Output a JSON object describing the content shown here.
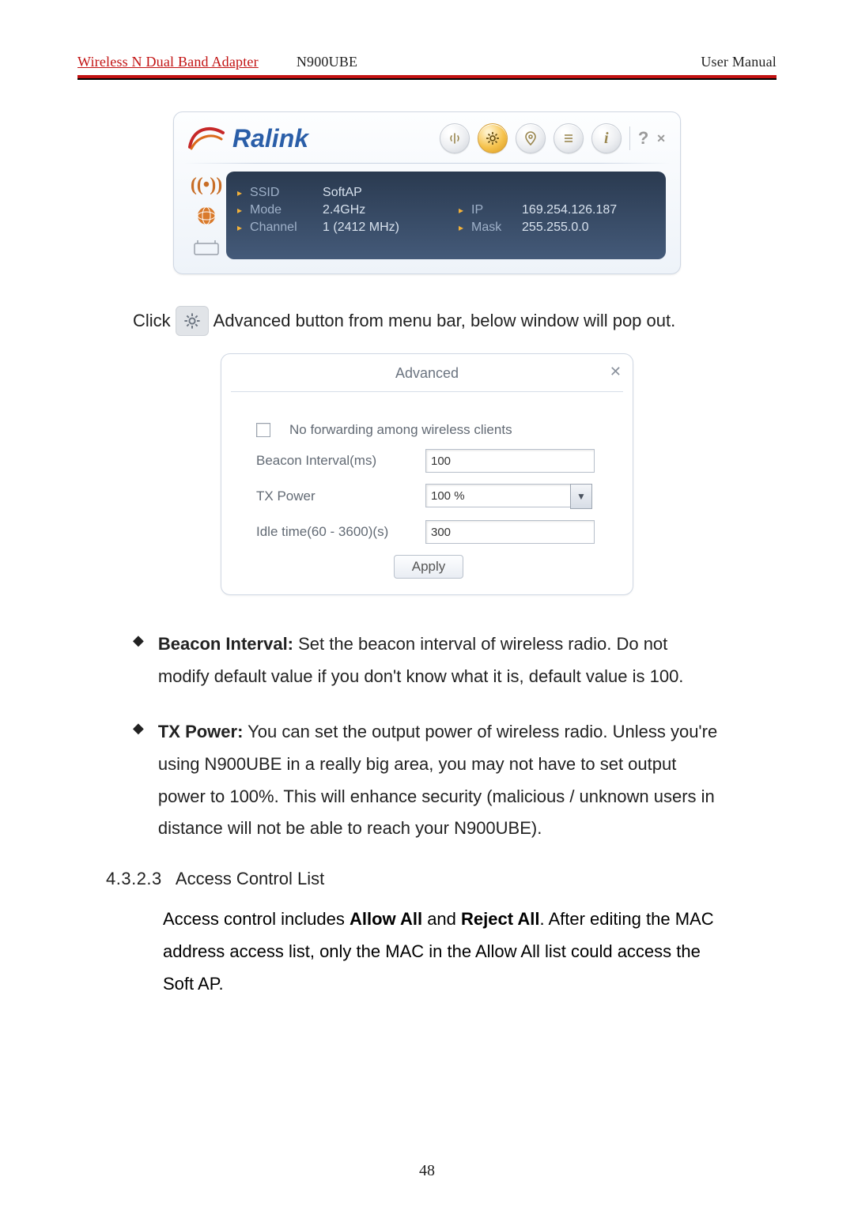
{
  "header": {
    "left": "Wireless N Dual Band Adapter",
    "mid": "N900UBE",
    "right": "User Manual"
  },
  "ralink": {
    "brand": "Ralink",
    "icons": {
      "antenna": "antenna-icon",
      "gear": "gear-icon",
      "map": "map-icon",
      "list": "list-icon",
      "info": "info-icon",
      "help": "?",
      "close": "✕"
    },
    "side": {
      "wifi": "((•))",
      "globe": "🌐",
      "keyboard": "⌨"
    },
    "labels": {
      "ssid": "SSID",
      "mode": "Mode",
      "channel": "Channel",
      "ip": "IP",
      "mask": "Mask"
    },
    "values": {
      "ssid": "SoftAP",
      "mode": "2.4GHz",
      "channel": "1 (2412 MHz)",
      "ip": "169.254.126.187",
      "mask": "255.255.0.0"
    }
  },
  "instruction": {
    "before": "Click",
    "after": " Advanced button from menu bar, below window will pop out."
  },
  "dialog": {
    "title": "Advanced",
    "close": "✕",
    "nofwd": "No forwarding among wireless clients",
    "beacon_label": "Beacon Interval(ms)",
    "beacon_value": "100",
    "tx_label": "TX Power",
    "tx_value": "100 %",
    "idle_label": "Idle time(60 - 3600)(s)",
    "idle_value": "300",
    "apply": "Apply"
  },
  "bullets": {
    "b1_bold": "Beacon Interval:",
    "b1_rest": " Set the beacon interval of wireless radio. Do not modify default value if you don't know what it is, default value is 100.",
    "b2_bold": "TX Power:",
    "b2_rest1": " You can set the output power of wireless radio. Unless you're using N900UBE in a really big area, you may not have to set output power to 100%. This will enhance security (malicious / unknown users in distance ",
    "b2_rest2": "will not be able to reach your N900UBE",
    "b2_rest3": ")."
  },
  "section": {
    "num": "4.3.2.3",
    "title": "Access Control List"
  },
  "acl_para": {
    "t1": "Access control includes ",
    "b1": "Allow All",
    "t2": " and ",
    "b2": "Reject All",
    "t3": ". After editing the MAC address access list, only the MAC in the Allow All list could access the Soft AP."
  },
  "page_number": "48"
}
